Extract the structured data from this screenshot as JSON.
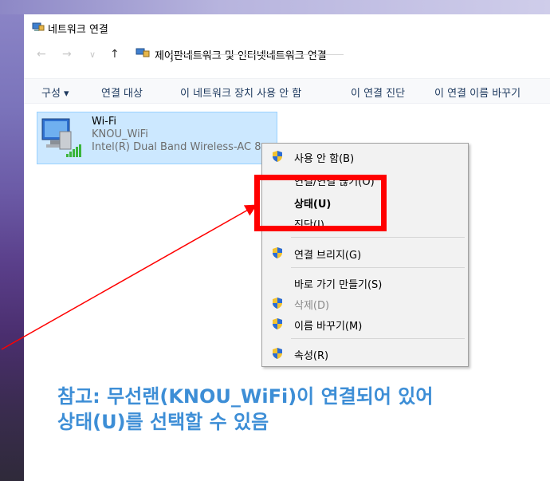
{
  "window": {
    "title": "네트워크 연결"
  },
  "address_bar": {
    "back": "←",
    "forward": "→",
    "recent": "∨",
    "up": "↑",
    "breadcrumbs": [
      "제어판",
      "네트워크 및 인터넷",
      "네트워크 연결"
    ],
    "separator": "›"
  },
  "command_bar": {
    "organize": "구성 ▾",
    "connect_to": "연결 대상",
    "disable_device": "이 네트워크 장치 사용 안 함",
    "diagnose": "이 연결 진단",
    "rename": "이 연결 이름 바꾸기"
  },
  "network_item": {
    "name": "Wi-Fi",
    "ssid": "KNOU_WiFi",
    "adapter": "Intel(R) Dual Band Wireless-AC 8"
  },
  "context_menu": {
    "items": [
      {
        "label": "사용 안 함(B)",
        "shield": true
      },
      {
        "label": "연결/연결 끊기(O)",
        "shield": false
      },
      {
        "label": "상태(U)",
        "shield": false,
        "bold": true
      },
      {
        "label": "진단(I)",
        "shield": false
      },
      {
        "label": "연결 브리지(G)",
        "shield": true
      },
      {
        "label": "바로 가기 만들기(S)",
        "shield": false
      },
      {
        "label": "삭제(D)",
        "shield": true,
        "disabled": true
      },
      {
        "label": "이름 바꾸기(M)",
        "shield": true
      },
      {
        "label": "속성(R)",
        "shield": true
      }
    ]
  },
  "annotation": {
    "line1": "참고: 무선랜(KNOU_WiFi)이 연결되어 있어",
    "line2": "상태(U)를 선택할 수 있음",
    "highlight_color": "#ff0000",
    "text_color": "#3d8ed6"
  },
  "colors": {
    "selection_bg": "#cce8ff",
    "menu_bg": "#f2f2f2"
  }
}
